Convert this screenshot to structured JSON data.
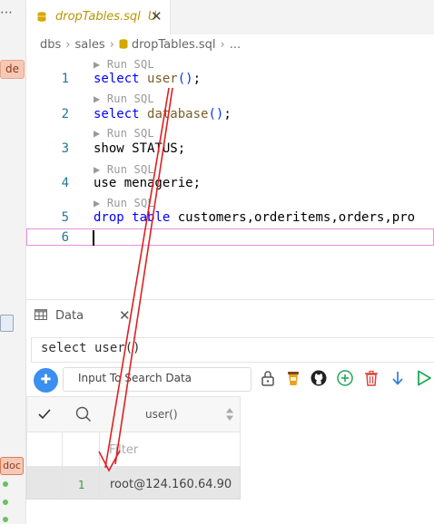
{
  "sidebar": {
    "ellipsis": "⋯",
    "tag_top": "de",
    "tag_bottom": "doc"
  },
  "editor": {
    "tab": {
      "label": "dropTables.sql",
      "status": "U",
      "close": "✕"
    },
    "breadcrumb": [
      "dbs",
      "sales",
      "dropTables.sql",
      "..."
    ],
    "codelens": "▶ Run SQL",
    "lines": [
      {
        "num": "1",
        "code": "select user();"
      },
      {
        "num": "2",
        "code": "select database();"
      },
      {
        "num": "3",
        "code": "show STATUS;"
      },
      {
        "num": "4",
        "code": "use menagerie;"
      },
      {
        "num": "5",
        "code": "drop table customers,orderitems,orders,pro"
      },
      {
        "num": "6",
        "code": ""
      }
    ]
  },
  "panel": {
    "tab_label": "Data",
    "tab_close": "✕",
    "query": "select user()",
    "search_placeholder": "Input To Search Data",
    "add_label": "✚",
    "grid": {
      "columns": [
        "user()"
      ],
      "filter_placeholder": "Filter",
      "rows": [
        {
          "num": "1",
          "values": [
            "root@124.160.64.90"
          ]
        }
      ]
    }
  },
  "colors": {
    "accent": "#3b8ff0",
    "annotation_arrow": "#e02020",
    "current_line_border": "#e88ee0"
  }
}
